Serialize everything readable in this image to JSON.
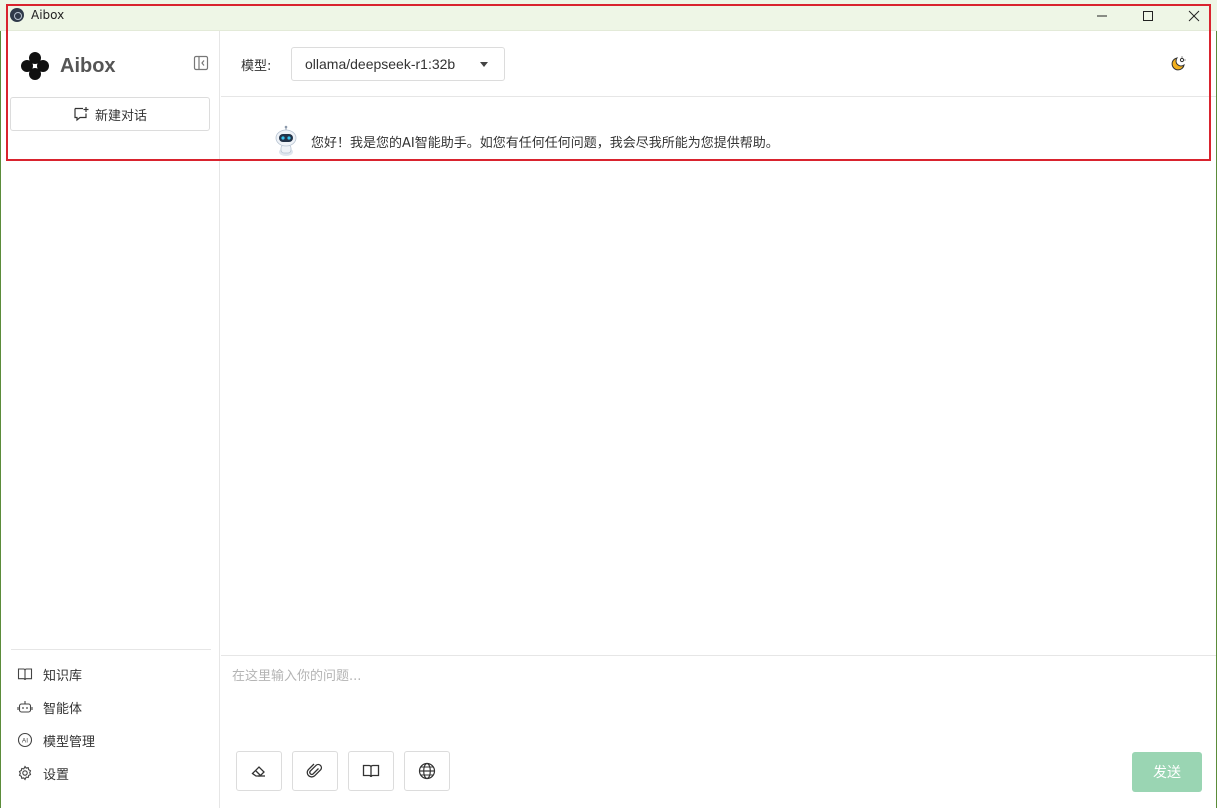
{
  "window": {
    "title": "Aibox",
    "controls": [
      "minimize-icon",
      "maximize-icon",
      "close-icon"
    ]
  },
  "sidebar": {
    "brand_name": "Aibox",
    "new_chat_label": "新建对话",
    "nav_items": [
      {
        "label": "知识库",
        "icon": "book-icon"
      },
      {
        "label": "智能体",
        "icon": "robot-icon"
      },
      {
        "label": "模型管理",
        "icon": "ai-circle-icon"
      },
      {
        "label": "设置",
        "icon": "gear-icon"
      }
    ]
  },
  "header": {
    "model_label": "模型:",
    "model_value": "ollama/deepseek-r1:32b"
  },
  "chat": {
    "messages": [
      {
        "role": "assistant",
        "text": "您好！我是您的AI智能助手。如您有任何任何问题，我会尽我所能为您提供帮助。"
      }
    ]
  },
  "composer": {
    "placeholder": "在这里输入你的问题...",
    "tools": [
      "eraser-icon",
      "paperclip-icon",
      "book-open-icon",
      "globe-icon"
    ],
    "send_label": "发送"
  },
  "colors": {
    "titlebar_bg": "#eef6e6",
    "send_button_bg": "#9ad5b3",
    "highlight_border": "#d9232e"
  }
}
